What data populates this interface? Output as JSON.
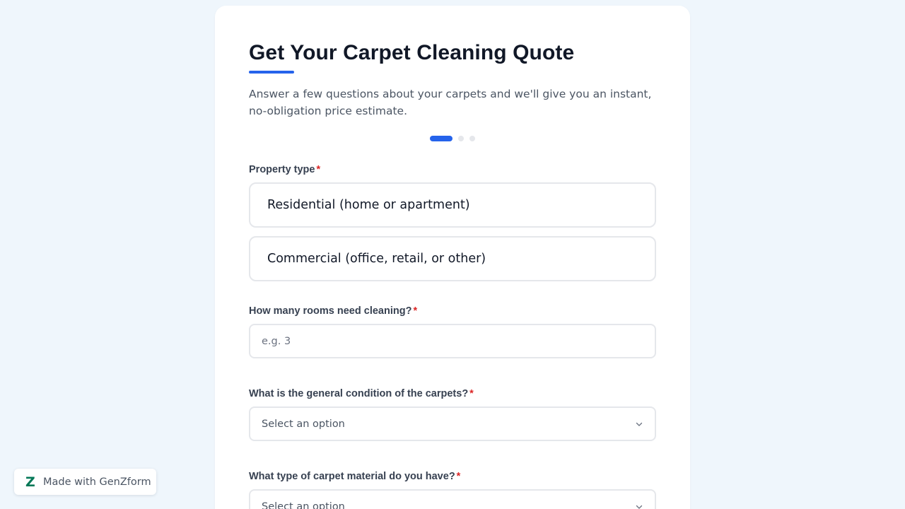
{
  "form": {
    "title": "Get Your Carpet Cleaning Quote",
    "subtitle": "Answer a few questions about your carpets and we'll give you an instant, no-obligation price estimate.",
    "progress": {
      "current_step": 1,
      "total_steps": 3
    },
    "accent_color": "#2563eb",
    "required_marker": "*",
    "property_type": {
      "label": "Property type",
      "options": [
        "Residential (home or apartment)",
        "Commercial (office, retail, or other)"
      ]
    },
    "rooms": {
      "label": "How many rooms need cleaning?",
      "placeholder": "e.g. 3",
      "value": ""
    },
    "condition": {
      "label": "What is the general condition of the carpets?",
      "placeholder": "Select an option",
      "icon": "chevron-down-icon"
    },
    "material": {
      "label": "What type of carpet material do you have?",
      "placeholder": "Select an option",
      "icon": "chevron-down-icon"
    }
  },
  "badge": {
    "logo_text": "Z",
    "text": "Made with GenZform",
    "logo_color": "#047857"
  }
}
